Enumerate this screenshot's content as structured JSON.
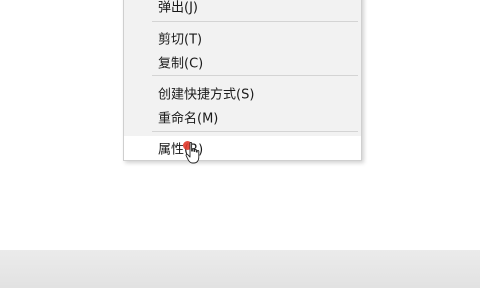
{
  "context_menu": {
    "items": [
      {
        "label": "弹出(J)"
      },
      {
        "label": "剪切(T)"
      },
      {
        "label": "复制(C)"
      },
      {
        "label": "创建快捷方式(S)"
      },
      {
        "label": "重命名(M)"
      },
      {
        "label": "属性(R)"
      }
    ]
  }
}
